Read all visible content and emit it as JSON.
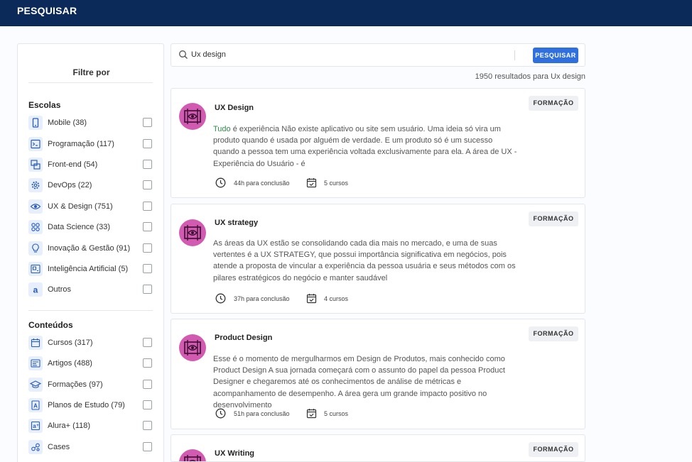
{
  "header": {
    "title": "PESQUISAR"
  },
  "search": {
    "value": "Ux design",
    "button_label": "PESQUISAR"
  },
  "results_label": "1950 resultados para Ux design",
  "sidebar": {
    "title": "Filtre por",
    "schools_title": "Escolas",
    "schools": [
      {
        "label": "Mobile (38)",
        "icon": "mobile-icon"
      },
      {
        "label": "Programação (117)",
        "icon": "terminal-icon"
      },
      {
        "label": "Front-end (54)",
        "icon": "frontend-icon"
      },
      {
        "label": "DevOps (22)",
        "icon": "gear-icon"
      },
      {
        "label": "UX & Design (751)",
        "icon": "eye-icon"
      },
      {
        "label": "Data Science (33)",
        "icon": "molecule-icon"
      },
      {
        "label": "Inovação & Gestão (91)",
        "icon": "lightbulb-icon"
      },
      {
        "label": "Inteligência Artificial (5)",
        "icon": "ai-icon"
      },
      {
        "label": "Outros",
        "icon": "alura-icon"
      }
    ],
    "contents_title": "Conteúdos",
    "contents": [
      {
        "label": "Cursos (317)",
        "icon": "calendar-icon"
      },
      {
        "label": "Artigos (488)",
        "icon": "article-icon"
      },
      {
        "label": "Formações (97)",
        "icon": "graduation-cap-icon"
      },
      {
        "label": "Planos de Estudo (79)",
        "icon": "plan-icon"
      },
      {
        "label": "Alura+ (118)",
        "icon": "alura-plus-icon"
      },
      {
        "label": "Cases",
        "icon": "cases-icon"
      }
    ]
  },
  "results": [
    {
      "title": "UX Design",
      "badge": "FORMAÇÃO",
      "desc_highlight": "Tudo",
      "desc": " é experiência Não existe aplicativo ou site sem usuário. Uma ideia só vira um produto quando é usada por alguém de verdade. E um produto só é um sucesso quando a pessoa tem uma experiência voltada exclusivamente para ela. A área de UX - Experiência do Usuário - é",
      "hours": "44h para conclusão",
      "courses": "5 cursos"
    },
    {
      "title": "UX strategy",
      "badge": "FORMAÇÃO",
      "desc_highlight": "",
      "desc": "As áreas da UX estão se consolidando cada dia mais no mercado, e uma de suas vertentes é a UX STRATEGY, que possui importância significativa em negócios, pois atende a proposta de vincular a experiência da pessoa usuária e seus métodos com os pilares estratégicos do negócio e manter saudável",
      "hours": "37h para conclusão",
      "courses": "4 cursos"
    },
    {
      "title": "Product Design",
      "badge": "FORMAÇÃO",
      "desc_highlight": "",
      "desc": "Esse é o momento de mergulharmos em Design de Produtos, mais conhecido como Product Design A sua jornada começará com o assunto do papel da pessoa Product Designer e chegaremos até os conhecimentos de análise de métricas e acompanhamento de desempenho. A área gera um grande impacto positivo no desenvolvimento",
      "hours": "51h para conclusão",
      "courses": "5 cursos"
    },
    {
      "title": "UX Writing",
      "badge": "FORMAÇÃO"
    }
  ],
  "colors": {
    "header_bg": "#0b2a5a",
    "accent": "#2f6fde",
    "card_icon": "#d25ab1"
  }
}
